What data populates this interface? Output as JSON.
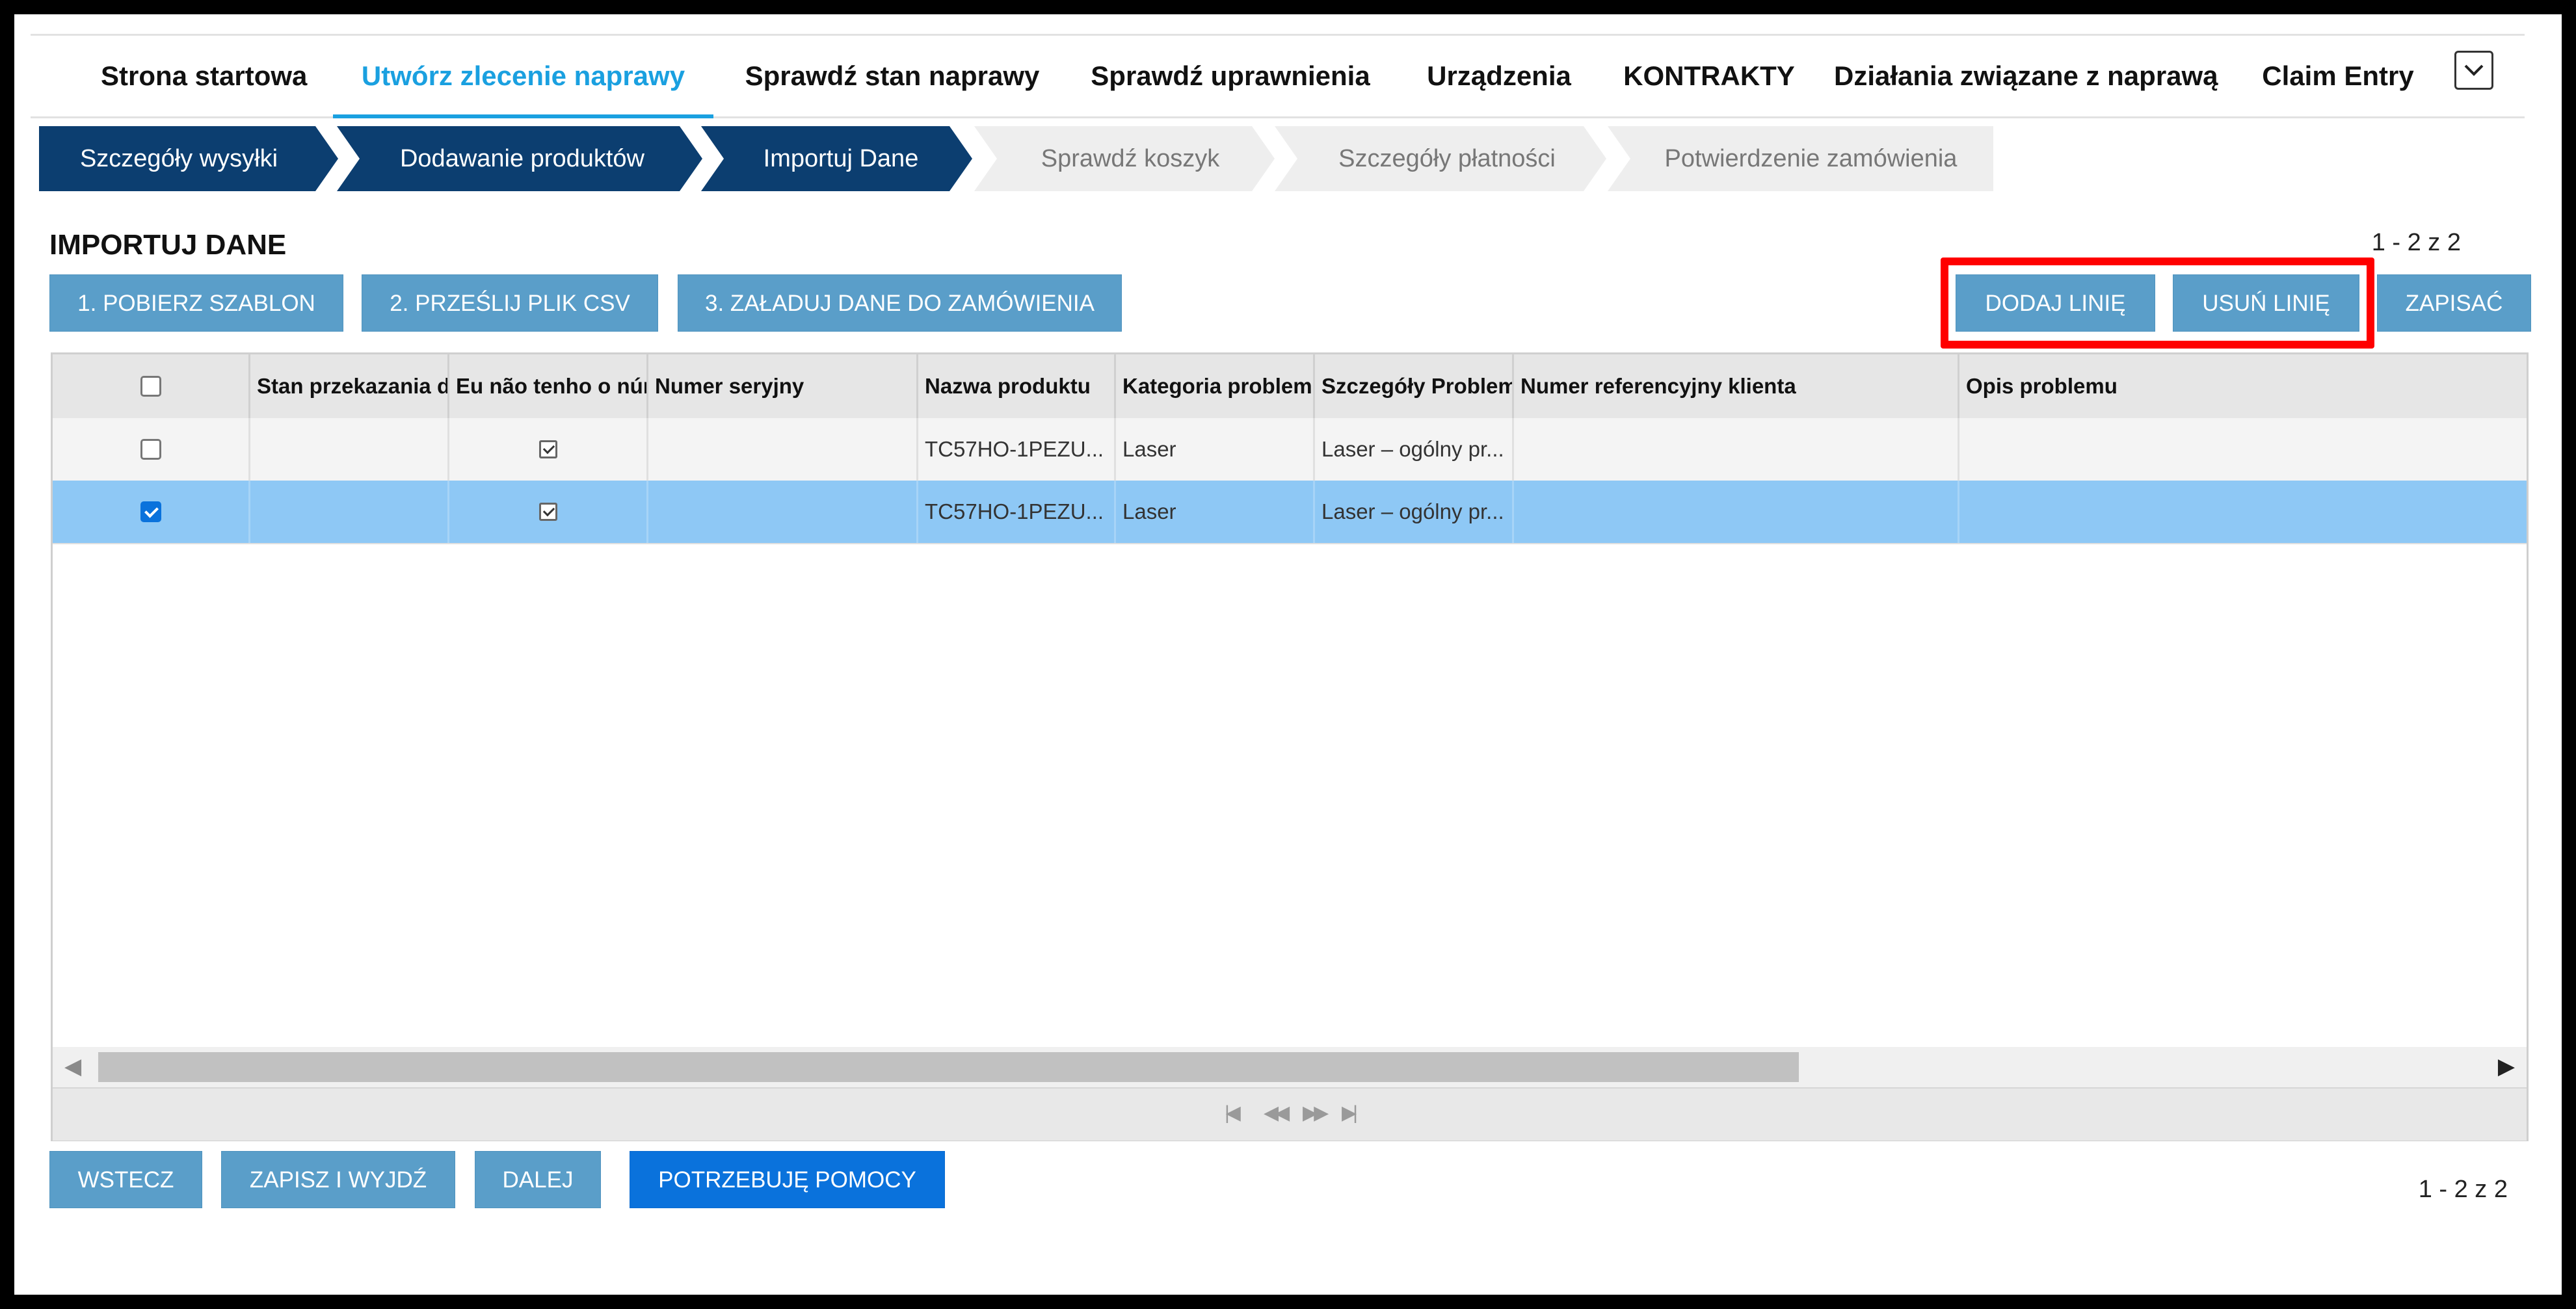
{
  "nav": {
    "tabs": [
      "Strona startowa",
      "Utwórz zlecenie naprawy",
      "Sprawdź stan naprawy",
      "Sprawdź uprawnienia",
      "Urządzenia",
      "KONTRAKTY",
      "Działania związane z naprawą",
      "Claim Entry"
    ],
    "active_tab": "Utwórz zlecenie naprawy",
    "more_icon": "chevron-down-icon"
  },
  "wizard": {
    "steps": [
      "Szczegóły wysyłki",
      "Dodawanie produktów",
      "Importuj Dane",
      "Sprawdź koszyk",
      "Szczegóły płatności",
      "Potwierdzenie zamówienia"
    ],
    "completed_steps": 3
  },
  "section": {
    "title": "IMPORTUJ DANE",
    "pager": "1 - 2 z 2"
  },
  "toolbar": {
    "download_template": "1. POBIERZ SZABLON",
    "upload_csv": "2. PRZEŚLIJ PLIK CSV",
    "load_data": "3. ZAŁADUJ DANE DO ZAMÓWIENIA",
    "add_line": "DODAJ LINIĘ",
    "remove_line": "USUŃ LINIĘ",
    "save": "ZAPISAĆ"
  },
  "grid": {
    "columns": [
      "Stan przekazania d",
      "Eu não tenho o núr",
      "Numer seryjny",
      "Nazwa produktu",
      "Kategoria problemu",
      "Szczegóły Problem",
      "Numer referencyjny klienta",
      "Opis problemu"
    ],
    "rows": [
      {
        "selected": false,
        "flag_checked": true,
        "serial": "",
        "product": "TC57HO-1PEZU...",
        "category": "Laser",
        "details": "Laser – ogólny pr...",
        "ref": "",
        "desc": ""
      },
      {
        "selected": true,
        "flag_checked": true,
        "serial": "",
        "product": "TC57HO-1PEZU...",
        "category": "Laser",
        "details": "Laser – ogólny pr...",
        "ref": "",
        "desc": ""
      }
    ],
    "pager_icons": [
      "first-page-icon",
      "prev-page-icon",
      "next-page-icon",
      "last-page-icon"
    ]
  },
  "footer": {
    "back": "WSTECZ",
    "save_exit": "ZAPISZ I WYJDŹ",
    "next": "DALEJ",
    "help": "POTRZEBUJĘ POMOCY",
    "pager": "1 - 2 z 2"
  },
  "colors": {
    "accent": "#1aa0e0",
    "step_done": "#0c3e70",
    "button": "#5a9ec9",
    "button_primary": "#0a72dc",
    "selected_row": "#8ec8f5",
    "highlight": "#ff0000"
  }
}
